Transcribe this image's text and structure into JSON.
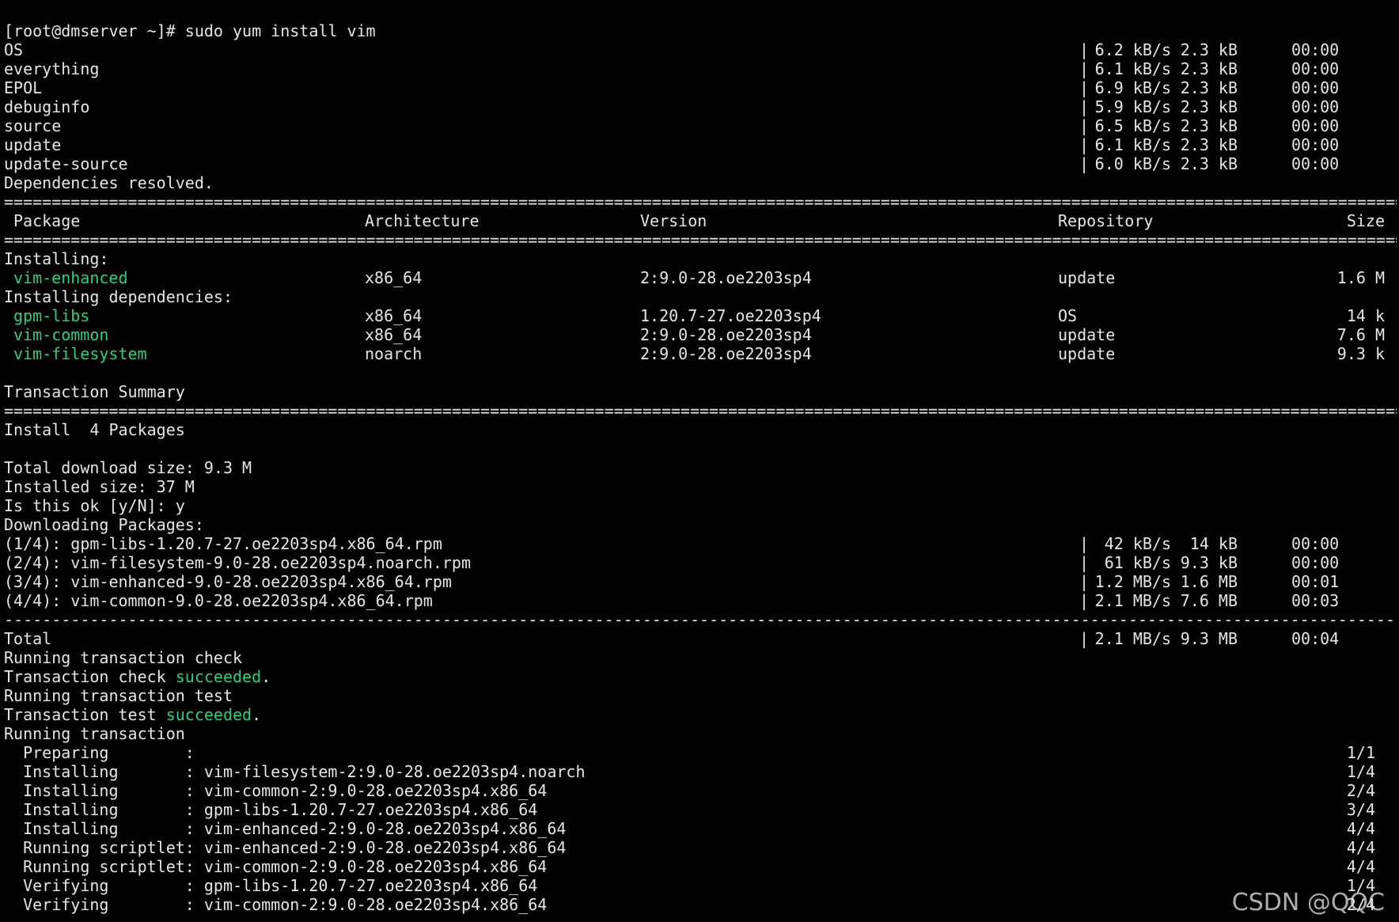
{
  "prompt": "[root@dmserver ~]# sudo yum install vim",
  "repos": [
    {
      "name": "OS",
      "speed": "6.2 kB/s",
      "size": "2.3 kB",
      "time": "00:00"
    },
    {
      "name": "everything",
      "speed": "6.1 kB/s",
      "size": "2.3 kB",
      "time": "00:00"
    },
    {
      "name": "EPOL",
      "speed": "6.9 kB/s",
      "size": "2.3 kB",
      "time": "00:00"
    },
    {
      "name": "debuginfo",
      "speed": "5.9 kB/s",
      "size": "2.3 kB",
      "time": "00:00"
    },
    {
      "name": "source",
      "speed": "6.5 kB/s",
      "size": "2.3 kB",
      "time": "00:00"
    },
    {
      "name": "update",
      "speed": "6.1 kB/s",
      "size": "2.3 kB",
      "time": "00:00"
    },
    {
      "name": "update-source",
      "speed": "6.0 kB/s",
      "size": "2.3 kB",
      "time": "00:00"
    }
  ],
  "deps_resolved": "Dependencies resolved.",
  "rule_double": "==========================================================================================================================================================================================",
  "rule_dash": "------------------------------------------------------------------------------------------------------------------------------------------------------------------------------------------",
  "table_header": {
    "package": "Package",
    "arch": "Architecture",
    "version": "Version",
    "repo": "Repository",
    "size": "Size"
  },
  "installing_label": "Installing:",
  "installing": [
    {
      "name": "vim-enhanced",
      "arch": "x86_64",
      "version": "2:9.0-28.oe2203sp4",
      "repo": "update",
      "size": "1.6 M"
    }
  ],
  "deps_label": "Installing dependencies:",
  "dependencies": [
    {
      "name": "gpm-libs",
      "arch": "x86_64",
      "version": "1.20.7-27.oe2203sp4",
      "repo": "OS",
      "size": "14 k"
    },
    {
      "name": "vim-common",
      "arch": "x86_64",
      "version": "2:9.0-28.oe2203sp4",
      "repo": "update",
      "size": "7.6 M"
    },
    {
      "name": "vim-filesystem",
      "arch": "noarch",
      "version": "2:9.0-28.oe2203sp4",
      "repo": "update",
      "size": "9.3 k"
    }
  ],
  "summary_title": "Transaction Summary",
  "install_count": "Install  4 Packages",
  "total_download": "Total download size: 9.3 M",
  "installed_size": "Installed size: 37 M",
  "confirm": "Is this ok [y/N]: y",
  "downloading": "Downloading Packages:",
  "downloads": [
    {
      "file": "(1/4): gpm-libs-1.20.7-27.oe2203sp4.x86_64.rpm",
      "speed": " 42 kB/s",
      "size": " 14 kB",
      "time": "00:00"
    },
    {
      "file": "(2/4): vim-filesystem-9.0-28.oe2203sp4.noarch.rpm",
      "speed": " 61 kB/s",
      "size": "9.3 kB",
      "time": "00:00"
    },
    {
      "file": "(3/4): vim-enhanced-9.0-28.oe2203sp4.x86_64.rpm",
      "speed": "1.2 MB/s",
      "size": "1.6 MB",
      "time": "00:01"
    },
    {
      "file": "(4/4): vim-common-9.0-28.oe2203sp4.x86_64.rpm",
      "speed": "2.1 MB/s",
      "size": "7.6 MB",
      "time": "00:03"
    }
  ],
  "total": {
    "label": "Total",
    "speed": "2.1 MB/s",
    "size": "9.3 MB",
    "time": "00:04"
  },
  "check_running": "Running transaction check",
  "check_prefix": "Transaction check ",
  "succeeded": "succeeded",
  "dot": ".",
  "test_running": "Running transaction test",
  "test_prefix": "Transaction test ",
  "running": "Running transaction",
  "steps": [
    {
      "action": "  Preparing        :",
      "target": "",
      "progress": "1/1"
    },
    {
      "action": "  Installing       :",
      "target": " vim-filesystem-2:9.0-28.oe2203sp4.noarch",
      "progress": "1/4"
    },
    {
      "action": "  Installing       :",
      "target": " vim-common-2:9.0-28.oe2203sp4.x86_64",
      "progress": "2/4"
    },
    {
      "action": "  Installing       :",
      "target": " gpm-libs-1.20.7-27.oe2203sp4.x86_64",
      "progress": "3/4"
    },
    {
      "action": "  Installing       :",
      "target": " vim-enhanced-2:9.0-28.oe2203sp4.x86_64",
      "progress": "4/4"
    },
    {
      "action": "  Running scriptlet:",
      "target": " vim-enhanced-2:9.0-28.oe2203sp4.x86_64",
      "progress": "4/4"
    },
    {
      "action": "  Running scriptlet:",
      "target": " vim-common-2:9.0-28.oe2203sp4.x86_64",
      "progress": "4/4"
    },
    {
      "action": "  Verifying        :",
      "target": " gpm-libs-1.20.7-27.oe2203sp4.x86_64",
      "progress": "1/4"
    },
    {
      "action": "  Verifying        :",
      "target": " vim-common-2:9.0-28.oe2203sp4.x86_64",
      "progress": "2/4"
    }
  ],
  "watermark": "CSDN @QQC",
  "colors": {
    "background": "#000000",
    "text": "#e6e6e6",
    "package_green": "#2ad17a"
  }
}
